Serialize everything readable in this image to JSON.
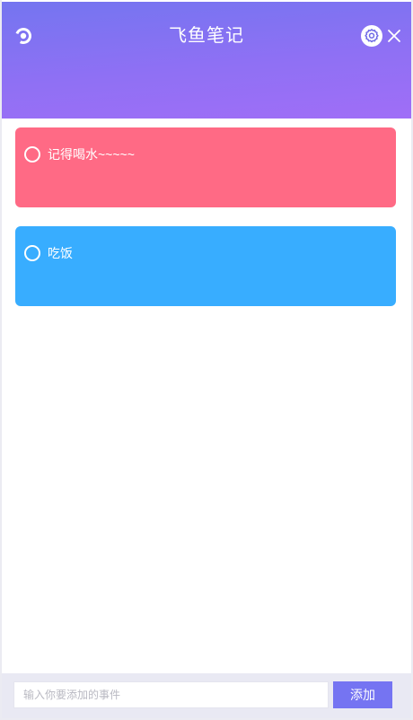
{
  "app": {
    "title": "飞鱼笔记",
    "icons": {
      "logo": "record-logo-icon",
      "settings": "gear-icon",
      "close": "close-icon"
    }
  },
  "notes": [
    {
      "text": "记得喝水~~~~~",
      "color": "#ff6a85",
      "done": false
    },
    {
      "text": "吃饭",
      "color": "#38adff",
      "done": false
    }
  ],
  "footer": {
    "input_placeholder": "输入你要添加的事件",
    "input_value": "",
    "add_label": "添加"
  },
  "colors": {
    "header_gradient_start": "#7475f0",
    "header_gradient_end": "#a06ef7",
    "add_button": "#7574f2",
    "footer_bg": "#e9e9f3"
  }
}
